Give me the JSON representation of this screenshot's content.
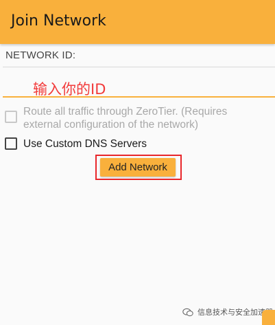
{
  "appbar": {
    "title": "Join Network"
  },
  "form": {
    "network_id_label": "NETWORK ID:",
    "annotation_hint": "输入你的ID",
    "route_all_label": "Route all traffic through ZeroTier. (Requires external configuration of the network)",
    "route_all_checked": false,
    "route_all_enabled": false,
    "custom_dns_label": "Use Custom DNS Servers",
    "custom_dns_checked": false,
    "add_button_label": "Add Network"
  },
  "watermark": {
    "text": "信息技术与安全加速器",
    "icon": "wechat-icon"
  },
  "colors": {
    "accent": "#f9b03c",
    "annotation_red": "#e8262a"
  }
}
